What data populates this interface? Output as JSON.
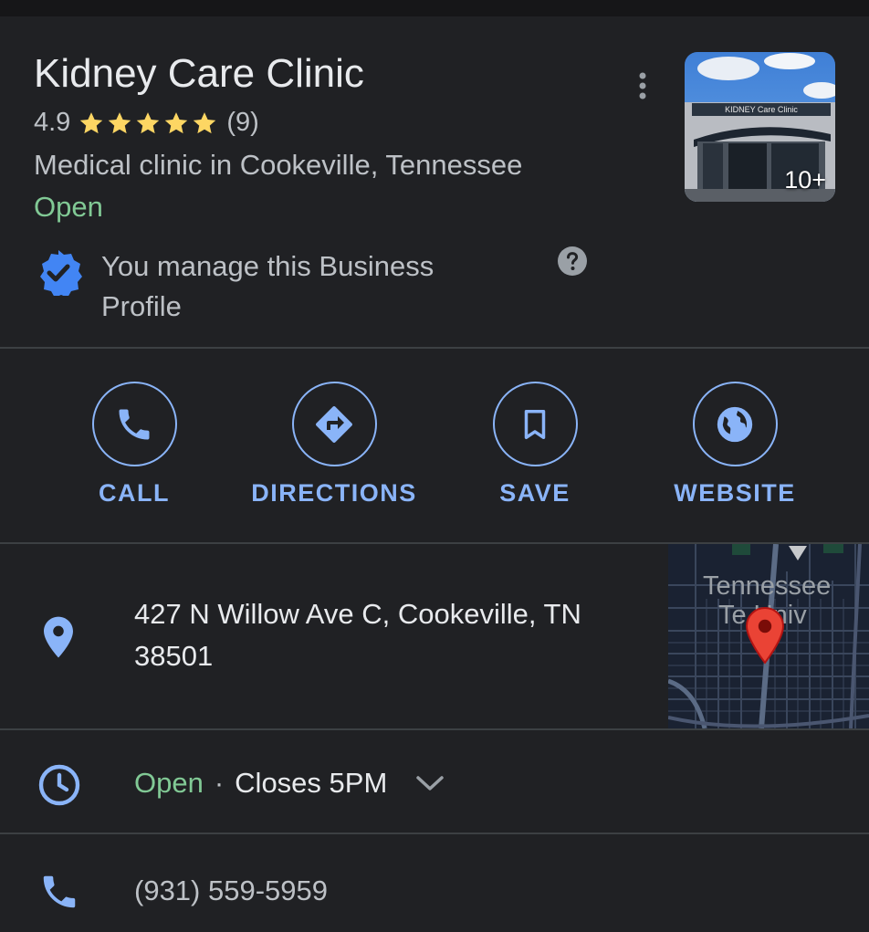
{
  "business": {
    "name": "Kidney Care Clinic",
    "rating": "4.9",
    "stars": 5,
    "review_count": "(9)",
    "category": "Medical clinic in Cookeville, Tennessee",
    "status": "Open",
    "manage_text": "You manage this Business Profile",
    "photo_count": "10+",
    "photo_sign": "KIDNEY Care Clinic"
  },
  "actions": [
    {
      "label": "CALL",
      "icon": "phone-icon"
    },
    {
      "label": "DIRECTIONS",
      "icon": "directions-icon"
    },
    {
      "label": "SAVE",
      "icon": "bookmark-icon"
    },
    {
      "label": "WEBSITE",
      "icon": "globe-icon"
    }
  ],
  "address": {
    "text": "427 N Willow Ave C, Cookeville, TN 38501",
    "map_label_line1": "Tennessee",
    "map_label_line2": "Te  Univ"
  },
  "hours": {
    "status": "Open",
    "separator": "·",
    "closes": "Closes 5PM"
  },
  "phone": {
    "number": "(931) 559-5959"
  },
  "colors": {
    "background": "#202124",
    "accent": "#8ab4f8",
    "open_green": "#81c995",
    "star": "#fdd663",
    "pin_red": "#ea4335"
  }
}
